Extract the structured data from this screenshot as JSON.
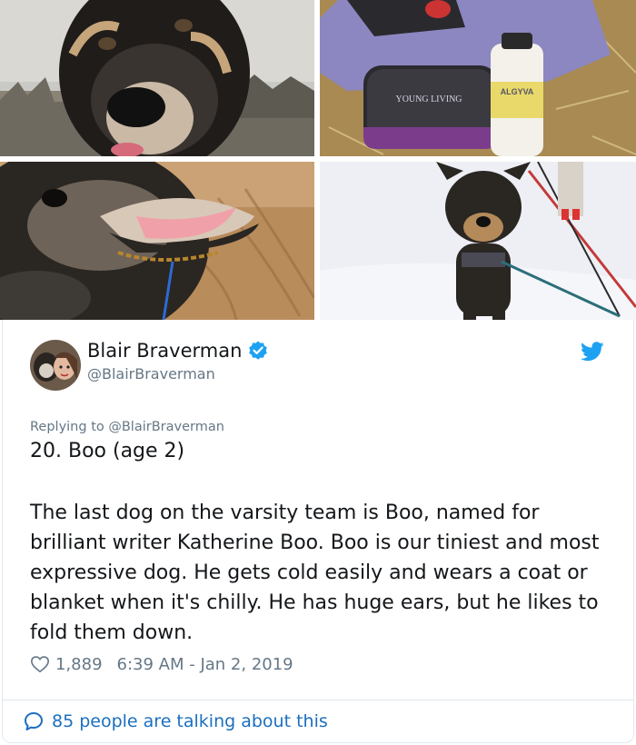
{
  "colors": {
    "accent": "#1da1f2",
    "link": "#1b6fbf",
    "secondary_text": "#657786",
    "border": "#e1e8ed"
  },
  "photos": [
    {
      "name": "photo-dog-closeup"
    },
    {
      "name": "photo-essential-oil-kit",
      "bag_logo": "YOUNG LIVING",
      "bottle_label": "ALGYVA"
    },
    {
      "name": "photo-dog-panting"
    },
    {
      "name": "photo-dog-in-snow"
    }
  ],
  "tweet": {
    "display_name": "Blair Braverman",
    "handle": "@BlairBraverman",
    "replying_prefix": "Replying to",
    "replying_handle": "@BlairBraverman",
    "title": "20. Boo (age 2)",
    "body": "The last dog on the varsity team is Boo, named for brilliant writer Katherine Boo. Boo is our tiniest and most expressive dog. He gets cold easily and wears a coat or blanket when it's chilly. He has huge ears, but he likes to fold them down.",
    "likes": "1,889",
    "timestamp": "6:39 AM - Jan 2, 2019",
    "talking": "85 people are talking about this"
  },
  "icons": {
    "verified": "verified-badge-icon",
    "bird": "twitter-bird-icon",
    "heart": "heart-outline-icon",
    "bubble": "speech-bubble-icon"
  }
}
